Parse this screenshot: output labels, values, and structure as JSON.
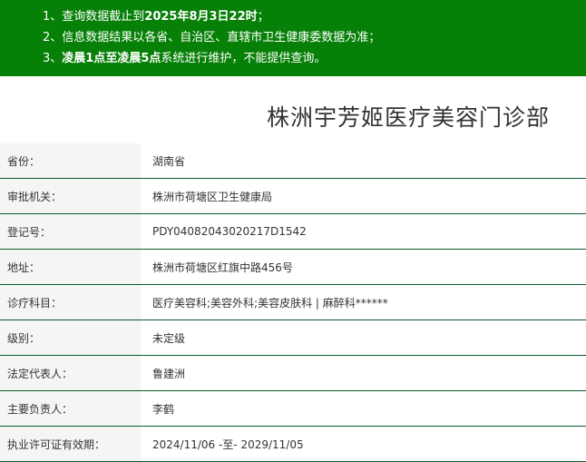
{
  "notice": {
    "line1_prefix": "1、查询数据截止到",
    "line1_bold": "2025年8月3日22时",
    "line1_suffix": "；",
    "line2": "2、信息数据结果以各省、自治区、直辖市卫生健康委数据为准；",
    "line3_prefix": "3、",
    "line3_bold": "凌晨1点至凌晨5点",
    "line3_suffix": "系统进行维护，不能提供查询。"
  },
  "page_title": "株洲宇芳姬医疗美容门诊部",
  "rows": [
    {
      "label": "省份：",
      "value": "湖南省"
    },
    {
      "label": "审批机关：",
      "value": "株洲市荷塘区卫生健康局"
    },
    {
      "label": "登记号：",
      "value": "PDY04082043020217D1542"
    },
    {
      "label": "地址：",
      "value": "株洲市荷塘区红旗中路456号"
    },
    {
      "label": "诊疗科目：",
      "value": "医疗美容科;美容外科;美容皮肤科 | 麻醉科******"
    },
    {
      "label": "级别：",
      "value": "未定级"
    },
    {
      "label": "法定代表人：",
      "value": "鲁建洲"
    },
    {
      "label": "主要负责人：",
      "value": "李鹤"
    },
    {
      "label": "执业许可证有效期：",
      "value": "2024/11/06 -至- 2029/11/05"
    }
  ],
  "colors": {
    "notice_bg": "#078007",
    "row_divider": "#0b5a2a",
    "label_bg": "#f5f5f5"
  }
}
